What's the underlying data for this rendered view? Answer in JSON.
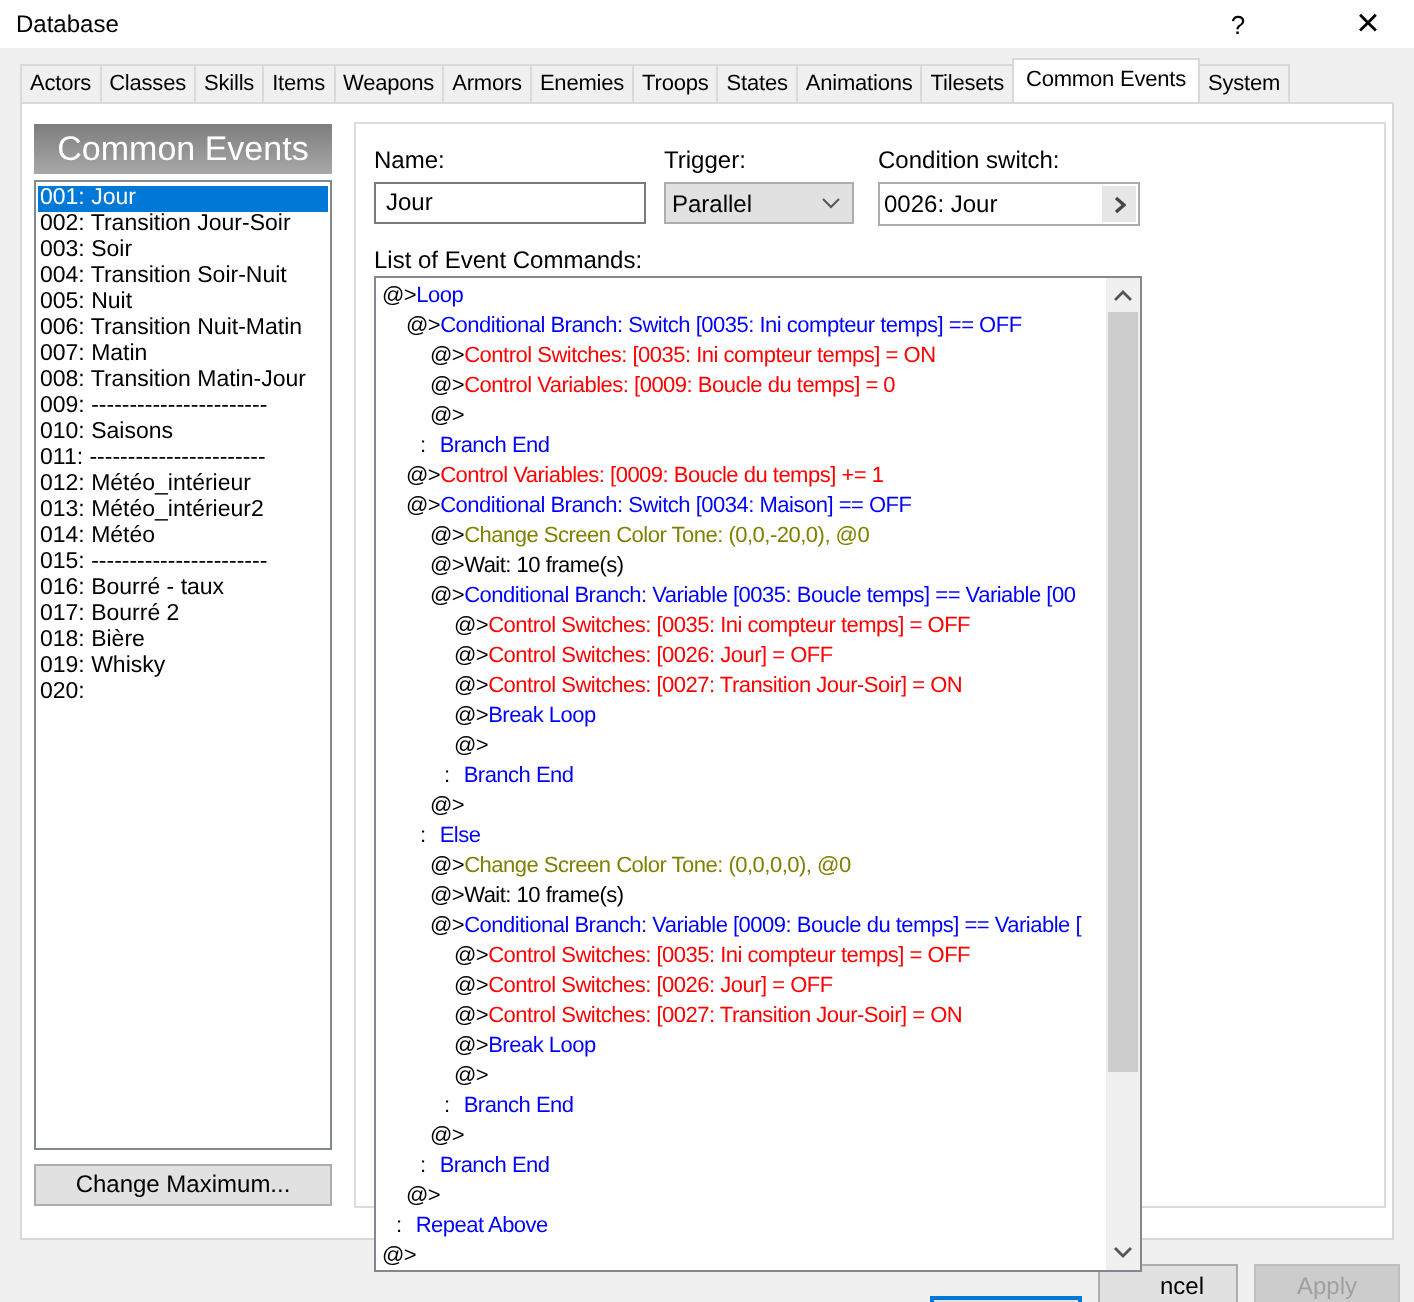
{
  "window": {
    "title": "Database",
    "help": "?",
    "close": "×"
  },
  "tabs": [
    {
      "label": "Actors",
      "selected": false
    },
    {
      "label": "Classes",
      "selected": false
    },
    {
      "label": "Skills",
      "selected": false
    },
    {
      "label": "Items",
      "selected": false
    },
    {
      "label": "Weapons",
      "selected": false
    },
    {
      "label": "Armors",
      "selected": false
    },
    {
      "label": "Enemies",
      "selected": false
    },
    {
      "label": "Troops",
      "selected": false
    },
    {
      "label": "States",
      "selected": false
    },
    {
      "label": "Animations",
      "selected": false
    },
    {
      "label": "Tilesets",
      "selected": false
    },
    {
      "label": "Common Events",
      "selected": true
    },
    {
      "label": "System",
      "selected": false
    }
  ],
  "sidebar": {
    "title": "Common Events",
    "button": "Change Maximum...",
    "items": [
      {
        "label": "001: Jour",
        "selected": true
      },
      {
        "label": "002: Transition Jour-Soir",
        "selected": false
      },
      {
        "label": "003: Soir",
        "selected": false
      },
      {
        "label": "004: Transition Soir-Nuit",
        "selected": false
      },
      {
        "label": "005: Nuit",
        "selected": false
      },
      {
        "label": "006: Transition Nuit-Matin",
        "selected": false
      },
      {
        "label": "007: Matin",
        "selected": false
      },
      {
        "label": "008: Transition Matin-Jour",
        "selected": false
      },
      {
        "label": "009: -----------------------",
        "selected": false
      },
      {
        "label": "010: Saisons",
        "selected": false
      },
      {
        "label": "011: -----------------------",
        "selected": false
      },
      {
        "label": "012: Météo_intérieur",
        "selected": false
      },
      {
        "label": "013: Météo_intérieur2",
        "selected": false
      },
      {
        "label": "014: Météo",
        "selected": false
      },
      {
        "label": "015: -----------------------",
        "selected": false
      },
      {
        "label": "016: Bourré - taux",
        "selected": false
      },
      {
        "label": "017: Bourré 2",
        "selected": false
      },
      {
        "label": "018: Bière",
        "selected": false
      },
      {
        "label": "019: Whisky",
        "selected": false
      },
      {
        "label": "020:",
        "selected": false
      }
    ]
  },
  "editor": {
    "name_label": "Name:",
    "name": "Jour",
    "trigger_label": "Trigger:",
    "trigger": "Parallel",
    "condition_label": "Condition switch:",
    "condition_switch": "0026: Jour",
    "commands_label": "List of Event Commands:",
    "commands": [
      {
        "marker": "@>",
        "text": "Loop",
        "kind": "flow",
        "children": [
          {
            "marker": "@>",
            "text": "Conditional Branch: Switch [0035: Ini compteur temps] == OFF",
            "kind": "flow",
            "children": [
              {
                "marker": "@>",
                "text": "Control Switches: [0035: Ini compteur temps] = ON",
                "kind": "control"
              },
              {
                "marker": "@>",
                "text": "Control Variables: [0009: Boucle du temps] = 0",
                "kind": "control"
              },
              {
                "marker": "@>",
                "kind": "plain"
              }
            ]
          },
          {
            "marker": ":",
            "text": "Branch End",
            "kind": "close"
          },
          {
            "marker": "@>",
            "text": "Control Variables: [0009: Boucle du temps] += 1",
            "kind": "control"
          },
          {
            "marker": "@>",
            "text": "Conditional Branch: Switch [0034: Maison] == OFF",
            "kind": "flow",
            "children": [
              {
                "marker": "@>",
                "text": "Change Screen Color Tone: (0,0,-20,0), @0",
                "kind": "screen"
              },
              {
                "marker": "@>",
                "text": "Wait: 10 frame(s)",
                "kind": "plain"
              },
              {
                "marker": "@>",
                "text": "Conditional Branch: Variable [0035: Boucle temps] == Variable [00",
                "kind": "flow",
                "children": [
                  {
                    "marker": "@>",
                    "text": "Control Switches: [0035: Ini compteur temps] = OFF",
                    "kind": "control"
                  },
                  {
                    "marker": "@>",
                    "text": "Control Switches: [0026: Jour] = OFF",
                    "kind": "control"
                  },
                  {
                    "marker": "@>",
                    "text": "Control Switches: [0027: Transition Jour-Soir] = ON",
                    "kind": "control"
                  },
                  {
                    "marker": "@>",
                    "text": "Break Loop",
                    "kind": "flow"
                  },
                  {
                    "marker": "@>",
                    "kind": "plain"
                  }
                ]
              },
              {
                "marker": ":",
                "text": "Branch End",
                "kind": "close"
              },
              {
                "marker": "@>",
                "kind": "plain"
              }
            ]
          },
          {
            "marker": ":",
            "text": "Else",
            "kind": "close",
            "children": [
              {
                "marker": "@>",
                "text": "Change Screen Color Tone: (0,0,0,0), @0",
                "kind": "screen"
              },
              {
                "marker": "@>",
                "text": "Wait: 10 frame(s)",
                "kind": "plain"
              },
              {
                "marker": "@>",
                "text": "Conditional Branch: Variable [0009: Boucle du temps] == Variable [",
                "kind": "flow",
                "children": [
                  {
                    "marker": "@>",
                    "text": "Control Switches: [0035: Ini compteur temps] = OFF",
                    "kind": "control"
                  },
                  {
                    "marker": "@>",
                    "text": "Control Switches: [0026: Jour] = OFF",
                    "kind": "control"
                  },
                  {
                    "marker": "@>",
                    "text": "Control Switches: [0027: Transition Jour-Soir] = ON",
                    "kind": "control"
                  },
                  {
                    "marker": "@>",
                    "text": "Break Loop",
                    "kind": "flow"
                  },
                  {
                    "marker": "@>",
                    "kind": "plain"
                  }
                ]
              },
              {
                "marker": ":",
                "text": "Branch End",
                "kind": "close"
              },
              {
                "marker": "@>",
                "kind": "plain"
              }
            ]
          },
          {
            "marker": ":",
            "text": "Branch End",
            "kind": "close"
          },
          {
            "marker": "@>",
            "kind": "plain"
          }
        ]
      },
      {
        "marker": ":",
        "text": "Repeat Above",
        "kind": "close"
      },
      {
        "marker": "@>",
        "kind": "plain"
      }
    ]
  },
  "buttons": [
    {
      "default": true,
      "disabled": false
    },
    {
      "label": "ncel",
      "default": false,
      "disabled": false
    },
    {
      "label": "Apply",
      "default": false,
      "disabled": true
    }
  ]
}
